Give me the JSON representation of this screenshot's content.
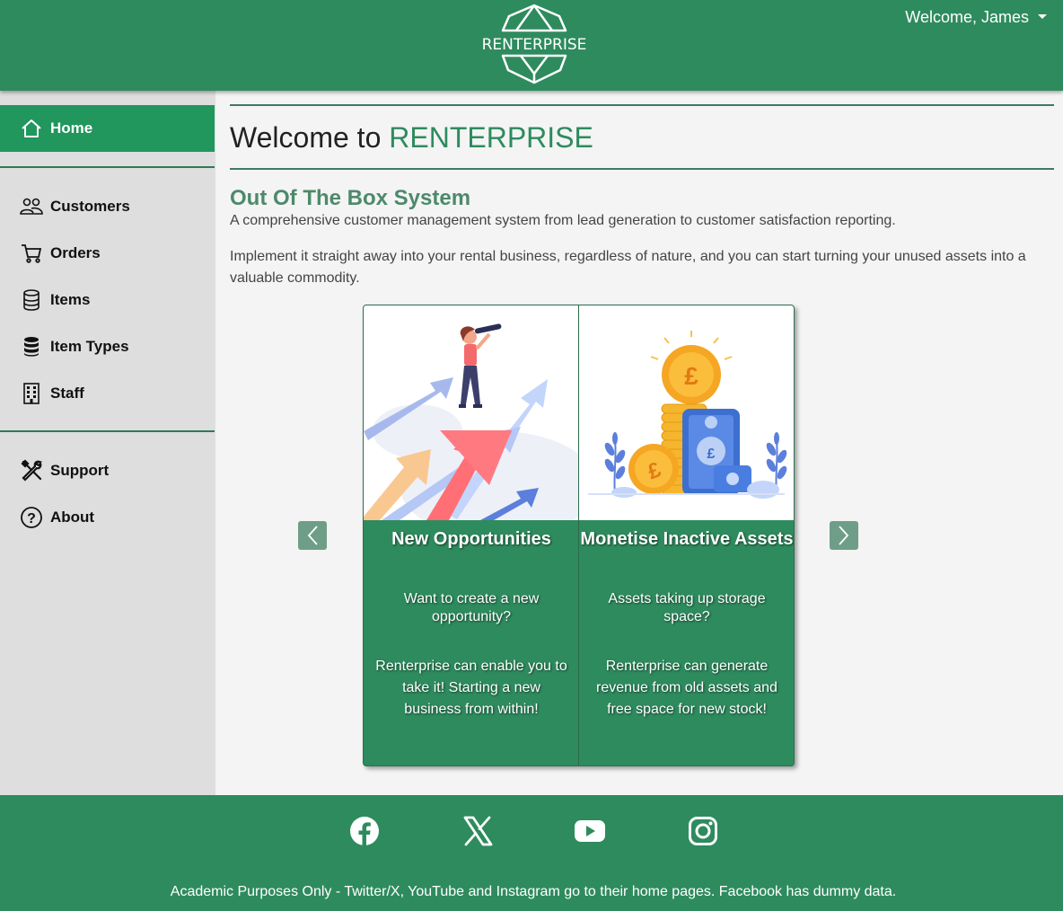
{
  "header": {
    "logo_text": "RENTERPRISE",
    "user_menu": "Welcome, James"
  },
  "sidebar": {
    "items": [
      {
        "label": "Home",
        "icon": "house-icon",
        "active": true
      },
      {
        "label": "Customers",
        "icon": "people-icon"
      },
      {
        "label": "Orders",
        "icon": "cart-icon"
      },
      {
        "label": "Items",
        "icon": "database-icon"
      },
      {
        "label": "Item Types",
        "icon": "database-fill-icon"
      },
      {
        "label": "Staff",
        "icon": "building-icon"
      },
      {
        "label": "Support",
        "icon": "tools-icon"
      },
      {
        "label": "About",
        "icon": "question-circle-icon"
      }
    ]
  },
  "main": {
    "title_prefix": "Welcome to ",
    "title_brand": "RENTERPRISE",
    "subtitle": "Out Of The Box System",
    "paragraph1": "A comprehensive customer management system from lead generation to customer satisfaction reporting.",
    "paragraph2": "Implement it straight away into your rental business, regardless of nature, and you can start turning your unused assets into a valuable commodity."
  },
  "carousel": {
    "slides": [
      {
        "title": "New Opportunities",
        "question": "Want to create a new opportunity?",
        "answer": "Renterprise can enable you to take it! Starting a new business from within!"
      },
      {
        "title": "Monetise Inactive Assets",
        "question": "Assets taking up storage space?",
        "answer": "Renterprise can generate revenue from old assets and free space for new stock!"
      }
    ]
  },
  "footer": {
    "social": [
      "facebook-icon",
      "x-twitter-icon",
      "youtube-icon",
      "instagram-icon"
    ],
    "text": "Academic Purposes Only - Twitter/X, YouTube and Instagram go to their home pages. Facebook has dummy data."
  },
  "colors": {
    "brand_green": "#2e8b5e",
    "active_nav": "#21965d",
    "sidebar_bg": "#dedede"
  }
}
